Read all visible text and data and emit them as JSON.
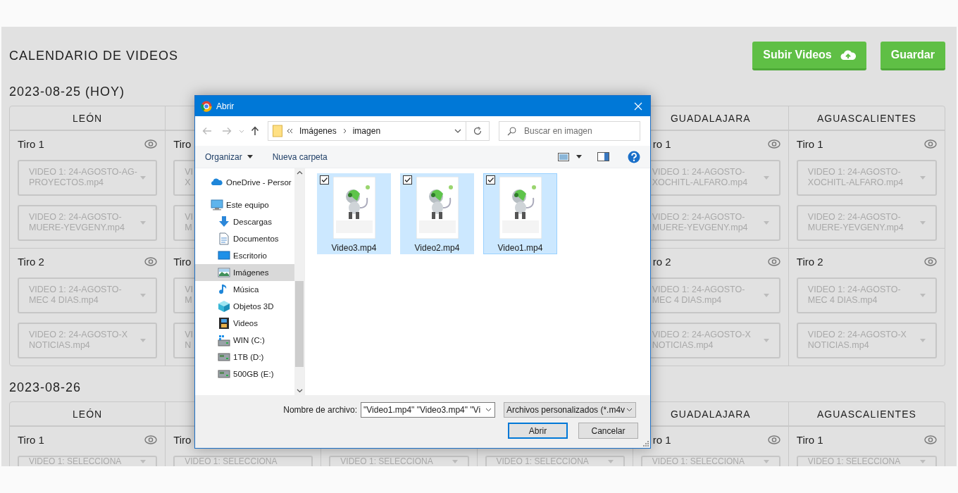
{
  "page": {
    "title": "CALENDARIO DE VIDEOS",
    "buttons": [
      {
        "label": "Subir Videos",
        "kind": "upload"
      },
      {
        "label": "Guardar",
        "kind": "save"
      }
    ]
  },
  "sections": [
    {
      "date": "2023-08-25 (HOY)",
      "columns": [
        {
          "kind": "open",
          "header": "LEÓN",
          "shots": [
            {
              "title": "Tiro 1",
              "videos": [
                "VIDEO 1: 24-AGOSTO-AG-\nPROYECTOS.mp4",
                "VIDEO 2: 24-AGOSTO-\nMUERE-YEVGENY.mp4"
              ]
            },
            {
              "title": "Tiro 2",
              "videos": [
                "VIDEO 1: 24-AGOSTO-\nMEC 4 DIAS.mp4",
                "VIDEO 2: 24-AGOSTO-X\nNOTICIAS.mp4"
              ]
            }
          ]
        },
        {
          "kind": "left_part",
          "shots": [
            {
              "title": "Tiro",
              "videos": [
                "VI\nX",
                "VI\nM"
              ]
            },
            {
              "title": "Tiro",
              "videos": [
                "VI\nM",
                "VI\nN"
              ]
            }
          ]
        },
        {
          "kind": "covered"
        },
        {
          "kind": "covered"
        },
        {
          "kind": "right_part",
          "header": "GUADALAJARA",
          "shots": [
            {
              "title": "ro 1",
              "videos": [
                "VIDEO 1: 24-AGOSTO-\nXOCHITL-ALFARO.mp4",
                "VIDEO 2: 24-AGOSTO-\nMUERE-YEVGENY.mp4"
              ]
            },
            {
              "title": "ro 2",
              "videos": [
                "VIDEO 1: 24-AGOSTO-\nMEC 4 DIAS.mp4",
                "VIDEO 2: 24-AGOSTO-X\nNOTICIAS.mp4"
              ]
            }
          ]
        },
        {
          "kind": "open",
          "header": "AGUASCALIENTES",
          "shots": [
            {
              "title": "Tiro 1",
              "videos": [
                "VIDEO 1: 24-AGOSTO-\nXOCHITL-ALFARO.mp4",
                "VIDEO 2: 24-AGOSTO-\nMUERE-YEVGENY.mp4"
              ]
            },
            {
              "title": "Tiro 2",
              "videos": [
                "VIDEO 1: 24-AGOSTO-\nMEC 4 DIAS.mp4",
                "VIDEO 2: 24-AGOSTO-X\nNOTICIAS.mp4"
              ]
            }
          ]
        }
      ]
    },
    {
      "date": "2023-08-26",
      "columns": [
        {
          "kind": "open",
          "header": "LEÓN",
          "shots": [
            {
              "title": "Tiro 1",
              "videos": [
                "VIDEO 1: SELECCIONA"
              ]
            }
          ]
        },
        {
          "kind": "left_part",
          "shots": [
            {
              "title": "Tiro",
              "videos": [
                "VIDEO 1: SELECCIONA"
              ]
            }
          ]
        },
        {
          "kind": "covered",
          "shots": [
            {
              "videos": [
                "VIDEO 1: SELECCIONA"
              ]
            }
          ]
        },
        {
          "kind": "covered",
          "shots": [
            {
              "videos": [
                "VIDEO 1: SELECCIONA"
              ]
            }
          ]
        },
        {
          "kind": "right_part",
          "header": "GUADALAJARA",
          "shots": [
            {
              "title": "ro 1",
              "videos": [
                "VIDEO 1: SELECCIONA"
              ]
            }
          ]
        },
        {
          "kind": "open",
          "header": "AGUASCALIENTES",
          "shots": [
            {
              "title": "Tiro 1",
              "videos": [
                "VIDEO 1: SELECCIONA"
              ]
            }
          ]
        }
      ]
    }
  ],
  "dialog": {
    "title": "Abrir",
    "path": [
      "Imágenes",
      "imagen"
    ],
    "search_placeholder": "Buscar en imagen",
    "toolbar": [
      "Organizar",
      "Nueva carpeta"
    ],
    "nav": [
      {
        "label": "OneDrive - Persor",
        "kind": "cloud",
        "selected": false
      },
      {
        "label": "Este equipo",
        "kind": "computer",
        "selected": false,
        "children": [
          {
            "label": "Descargas",
            "kind": "download",
            "selected": false
          },
          {
            "label": "Documentos",
            "kind": "document",
            "selected": false
          },
          {
            "label": "Escritorio",
            "kind": "desktop",
            "selected": false
          },
          {
            "label": "Imágenes",
            "kind": "pictures",
            "selected": true
          },
          {
            "label": "Música",
            "kind": "music",
            "selected": false
          },
          {
            "label": "Objetos 3D",
            "kind": "cube",
            "selected": false
          },
          {
            "label": "Videos",
            "kind": "film",
            "selected": false
          },
          {
            "label": "WIN (C:)",
            "kind": "system_drive",
            "selected": false
          },
          {
            "label": "1TB (D:)",
            "kind": "drive",
            "selected": false
          },
          {
            "label": "500GB (E:)",
            "kind": "drive",
            "selected": false
          }
        ]
      }
    ],
    "files": [
      {
        "name": "Video3.mp4",
        "kind": "picture",
        "selected": true,
        "checked": true,
        "focused": false
      },
      {
        "name": "Video2.mp4",
        "kind": "picture",
        "selected": true,
        "checked": true,
        "focused": false
      },
      {
        "name": "Video1.mp4",
        "kind": "picture",
        "selected": true,
        "checked": true,
        "focused": true
      }
    ],
    "filename_label": "Nombre de archivo:",
    "filename": "\"Video1.mp4\" \"Video3.mp4\" \"Vi",
    "filetype": "Archivos personalizados (*.m4v",
    "buttons": [
      {
        "label": "Abrir",
        "default": true
      },
      {
        "label": "Cancelar",
        "default": false
      }
    ]
  }
}
